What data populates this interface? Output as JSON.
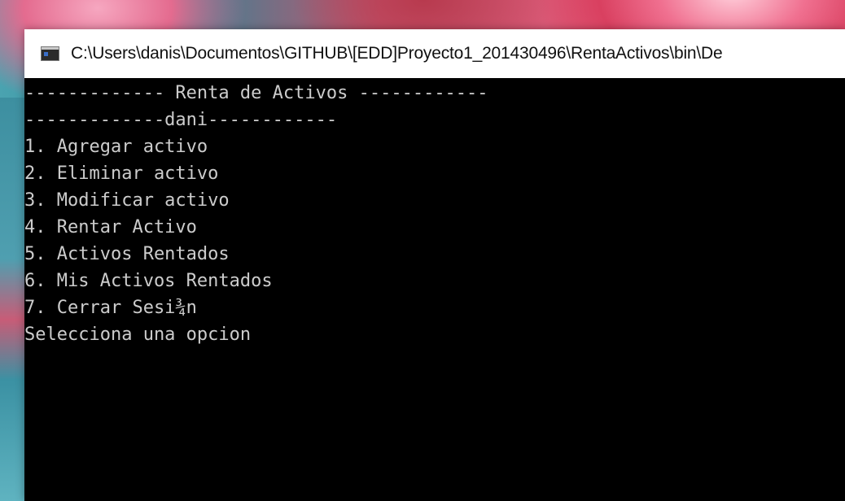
{
  "window": {
    "title": "C:\\Users\\danis\\Documentos\\GITHUB\\[EDD]Proyecto1_201430496\\RentaActivos\\bin\\De",
    "icon": "console-window-icon"
  },
  "console": {
    "header": "------------- Renta de Activos ------------",
    "user_line": "-------------dani------------",
    "menu": [
      "1. Agregar activo",
      "2. Eliminar activo",
      "3. Modificar activo",
      "4. Rentar Activo",
      "5. Activos Rentados",
      "6. Mis Activos Rentados",
      "7. Cerrar Sesi¾n"
    ],
    "prompt": "Selecciona una opcion"
  },
  "colors": {
    "console_background": "#000000",
    "console_text": "#cccccc",
    "titlebar_background": "#ffffff"
  }
}
